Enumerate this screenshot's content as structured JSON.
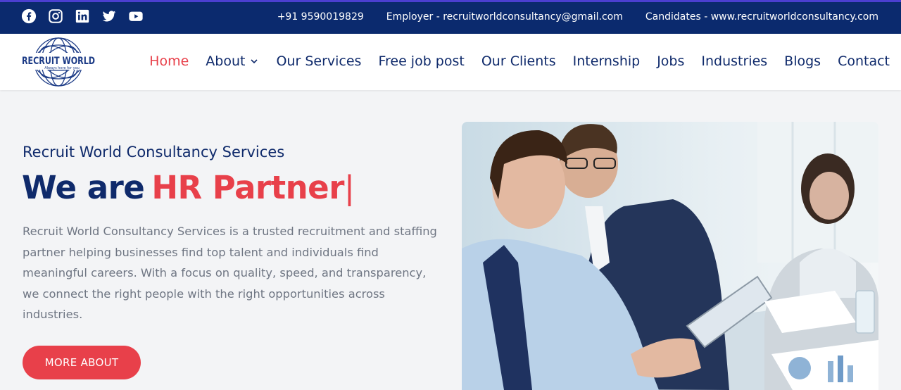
{
  "topbar": {
    "socials": [
      "facebook-icon",
      "instagram-icon",
      "linkedin-icon",
      "twitter-icon",
      "youtube-icon"
    ],
    "phone": "+91 9590019829",
    "employer": "Employer - recruitworldconsultancy@gmail.com",
    "candidates": "Candidates - www.recruitworldconsultancy.com"
  },
  "logo": {
    "name": "RECRUIT WORLD",
    "tagline": "Always here for you"
  },
  "nav": {
    "items": [
      "Home",
      "About",
      "Our Services",
      "Free job post",
      "Our Clients",
      "Internship",
      "Jobs",
      "Industries",
      "Blogs",
      "Contact"
    ],
    "active": "Home"
  },
  "hero": {
    "eyebrow": "Recruit World Consultancy Services",
    "headline_a": "We are",
    "headline_b": "HR Partner",
    "cursor": "|",
    "description": "Recruit World Consultancy Services is a trusted recruitment and staffing partner helping businesses find top talent and individuals find meaningful careers. With a focus on quality, speed, and transparency, we connect the right people with the right opportunities across industries.",
    "button": "MORE ABOUT"
  },
  "colors": {
    "navy": "#0b2a6e",
    "accent": "#e8404a",
    "text_muted": "#6f7683"
  }
}
